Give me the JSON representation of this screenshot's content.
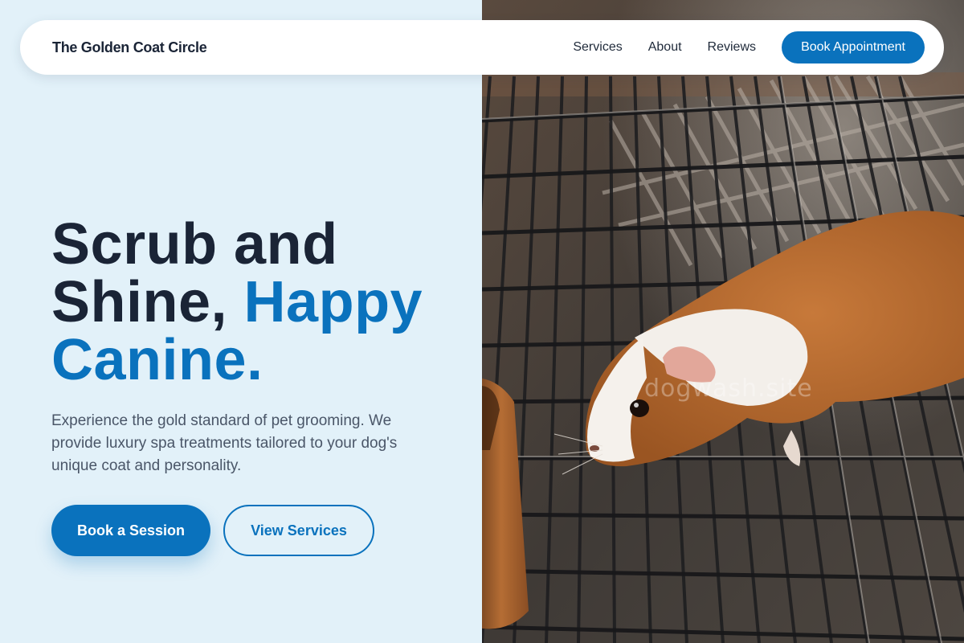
{
  "nav": {
    "brand": "The Golden Coat Circle",
    "links": [
      "Services",
      "About",
      "Reviews"
    ],
    "cta_label": "Book Appointment"
  },
  "hero": {
    "headline_part1": "Scrub and Shine, ",
    "headline_accent": "Happy Canine.",
    "description": "Experience the gold standard of pet grooming. We provide luxury spa treatments tailored to your dog's unique coat and personality.",
    "primary_button": "Book a Session",
    "secondary_button": "View Services"
  },
  "image": {
    "subject": "guinea pig on wire cage floor",
    "watermark": "dogwash.site"
  },
  "colors": {
    "accent": "#0a72bd",
    "background": "#e2f1f9",
    "text_dark": "#1a2436",
    "text_muted": "#4a5668"
  }
}
